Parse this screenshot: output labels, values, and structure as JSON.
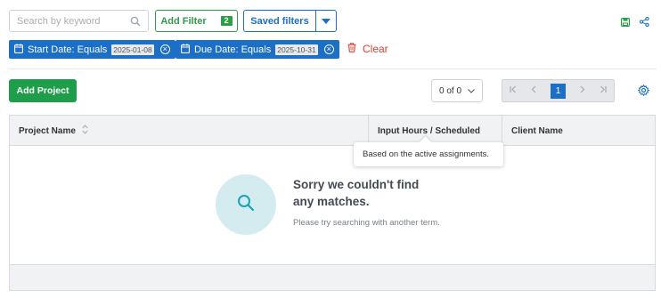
{
  "search": {
    "placeholder": "Search by keyword"
  },
  "filters": {
    "add_label": "Add Filter",
    "count": "2",
    "saved_label": "Saved filters"
  },
  "chips": [
    {
      "label": "Start Date: Equals",
      "value": "2025-01-08"
    },
    {
      "label": "Due Date: Equals",
      "value": "2025-10-31"
    }
  ],
  "clear_label": "Clear",
  "toolbar": {
    "add_project_label": "Add Project",
    "page_count": "0 of 0",
    "current_page": "1"
  },
  "table": {
    "columns": [
      "Project Name",
      "Input Hours / Scheduled",
      "Client Name"
    ],
    "tooltip": "Based on the active assignments.",
    "empty_title": "Sorry we couldn't find any matches.",
    "empty_subtitle": "Please try searching with another term."
  },
  "colors": {
    "green": "#2e9d48",
    "blue": "#1b6fc6",
    "red": "#e03c31"
  },
  "icons": [
    "search-icon",
    "chevron-down-icon",
    "save-icon",
    "share-icon",
    "calendar-icon",
    "close-circle-icon",
    "trash-icon",
    "first-page-icon",
    "prev-page-icon",
    "next-page-icon",
    "last-page-icon",
    "gear-icon",
    "sort-icon"
  ]
}
